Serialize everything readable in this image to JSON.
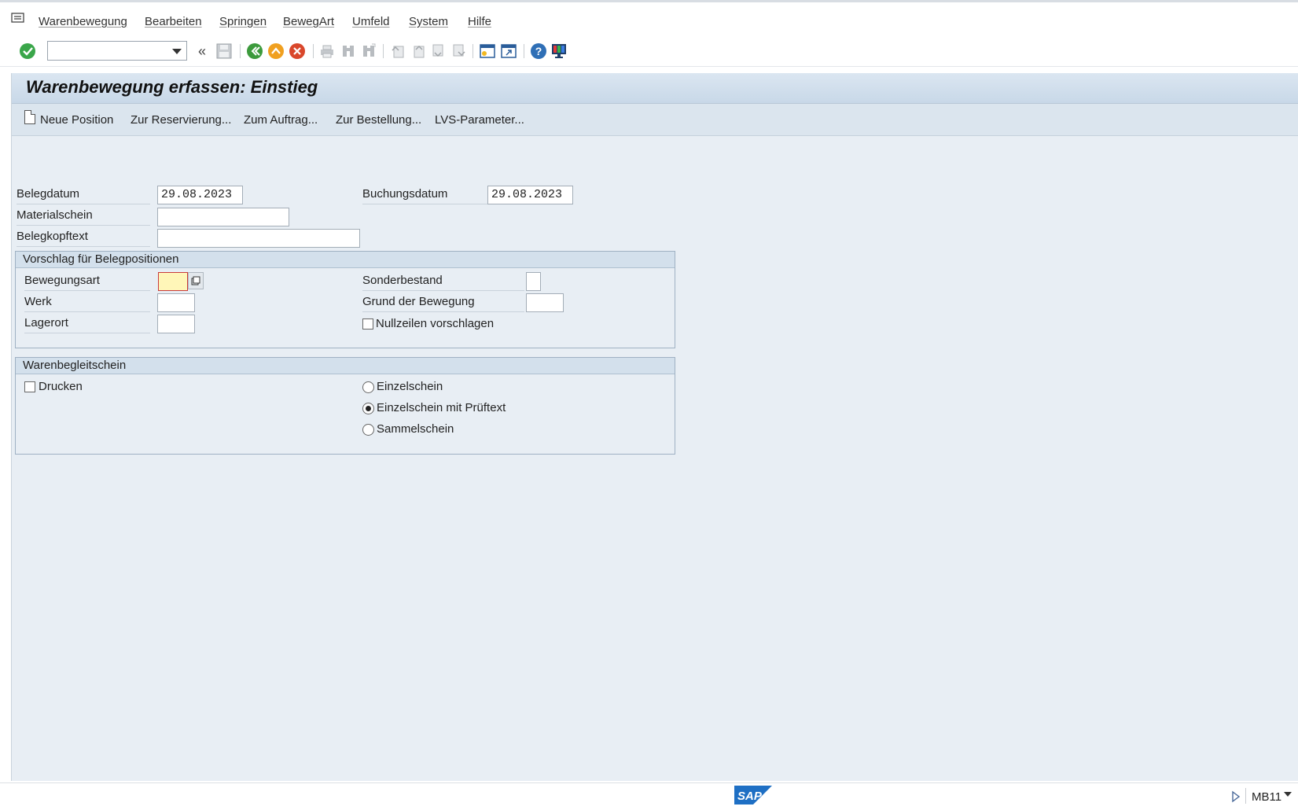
{
  "menubar": {
    "items": [
      "Warenbewegung",
      "Bearbeiten",
      "Springen",
      "BewegArt",
      "Umfeld",
      "System",
      "Hilfe"
    ]
  },
  "toolbar": {
    "command_field_value": ""
  },
  "page": {
    "title": "Warenbewegung erfassen: Einstieg"
  },
  "appbar": {
    "new_item_label": "Neue Position",
    "buttons": [
      "Zur Reservierung...",
      "Zum Auftrag...",
      "Zur Bestellung...",
      "LVS-Parameter..."
    ]
  },
  "header": {
    "belegdatum_label": "Belegdatum",
    "belegdatum_value": "29.08.2023",
    "buchungsdatum_label": "Buchungsdatum",
    "buchungsdatum_value": "29.08.2023",
    "materialschein_label": "Materialschein",
    "materialschein_value": "",
    "belegkopftext_label": "Belegkopftext",
    "belegkopftext_value": ""
  },
  "vorschlag": {
    "title": "Vorschlag für Belegpositionen",
    "bewegungsart_label": "Bewegungsart",
    "bewegungsart_value": "",
    "werk_label": "Werk",
    "werk_value": "",
    "lagerort_label": "Lagerort",
    "lagerort_value": "",
    "sonderbestand_label": "Sonderbestand",
    "sonderbestand_value": "",
    "grund_label": "Grund der Bewegung",
    "grund_value": "",
    "nullzeilen_label": "Nullzeilen vorschlagen",
    "nullzeilen_checked": false
  },
  "warenbegleitschein": {
    "title": "Warenbegleitschein",
    "drucken_label": "Drucken",
    "drucken_checked": false,
    "options": [
      "Einzelschein",
      "Einzelschein mit Prüftext",
      "Sammelschein"
    ],
    "selected_option": "Einzelschein mit Prüftext"
  },
  "statusbar": {
    "logo_text": "SAP",
    "tcode": "MB11"
  },
  "colors": {
    "title_bg": "#c8d8e8",
    "main_bg": "#e8eef4",
    "focus_field_bg": "#fff6b8",
    "focus_border": "#c93a3a"
  }
}
